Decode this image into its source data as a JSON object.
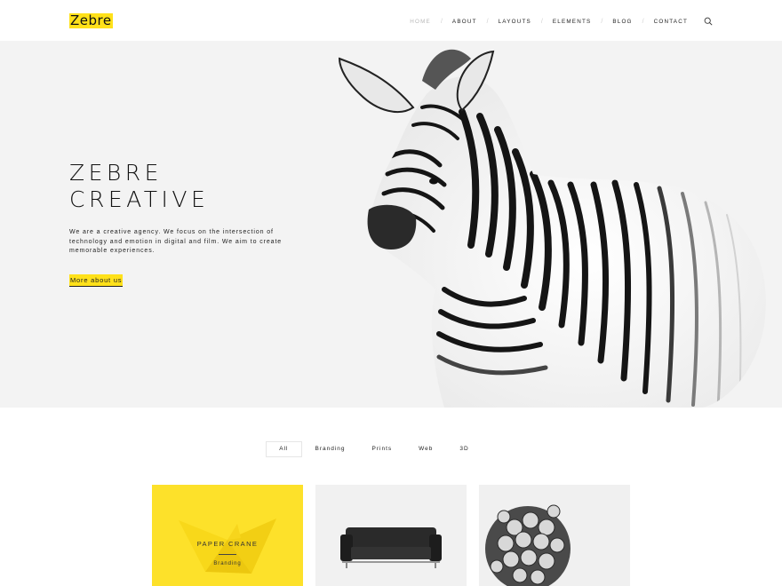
{
  "header": {
    "logo": "Zebre",
    "nav": [
      {
        "label": "HOME",
        "active": true
      },
      {
        "label": "ABOUT",
        "active": false
      },
      {
        "label": "LAYOUTS",
        "active": false
      },
      {
        "label": "ELEMENTS",
        "active": false
      },
      {
        "label": "BLOG",
        "active": false
      },
      {
        "label": "CONTACT",
        "active": false
      }
    ],
    "separator": "/",
    "search_icon": "search-icon"
  },
  "hero": {
    "title_line1": "ZEBRE",
    "title_line2": "CREATIVE",
    "description": "We are a creative agency. We focus on the intersection of technology and emotion in digital and film. We aim to create memorable experiences.",
    "cta_label": "More about us",
    "image": "zebra-photo"
  },
  "filters": [
    {
      "label": "All",
      "active": true
    },
    {
      "label": "Branding",
      "active": false
    },
    {
      "label": "Prints",
      "active": false
    },
    {
      "label": "Web",
      "active": false
    },
    {
      "label": "3D",
      "active": false
    }
  ],
  "portfolio": [
    {
      "title": "PAPER CRANE",
      "category": "Branding",
      "image": "paper-crane-image"
    },
    {
      "image": "sofa-image"
    },
    {
      "image": "hydrangea-flower-image"
    }
  ],
  "colors": {
    "accent": "#ffe11a",
    "hero_bg": "#f3f3f3",
    "text": "#111111",
    "nav_active": "#b9b9b9"
  }
}
